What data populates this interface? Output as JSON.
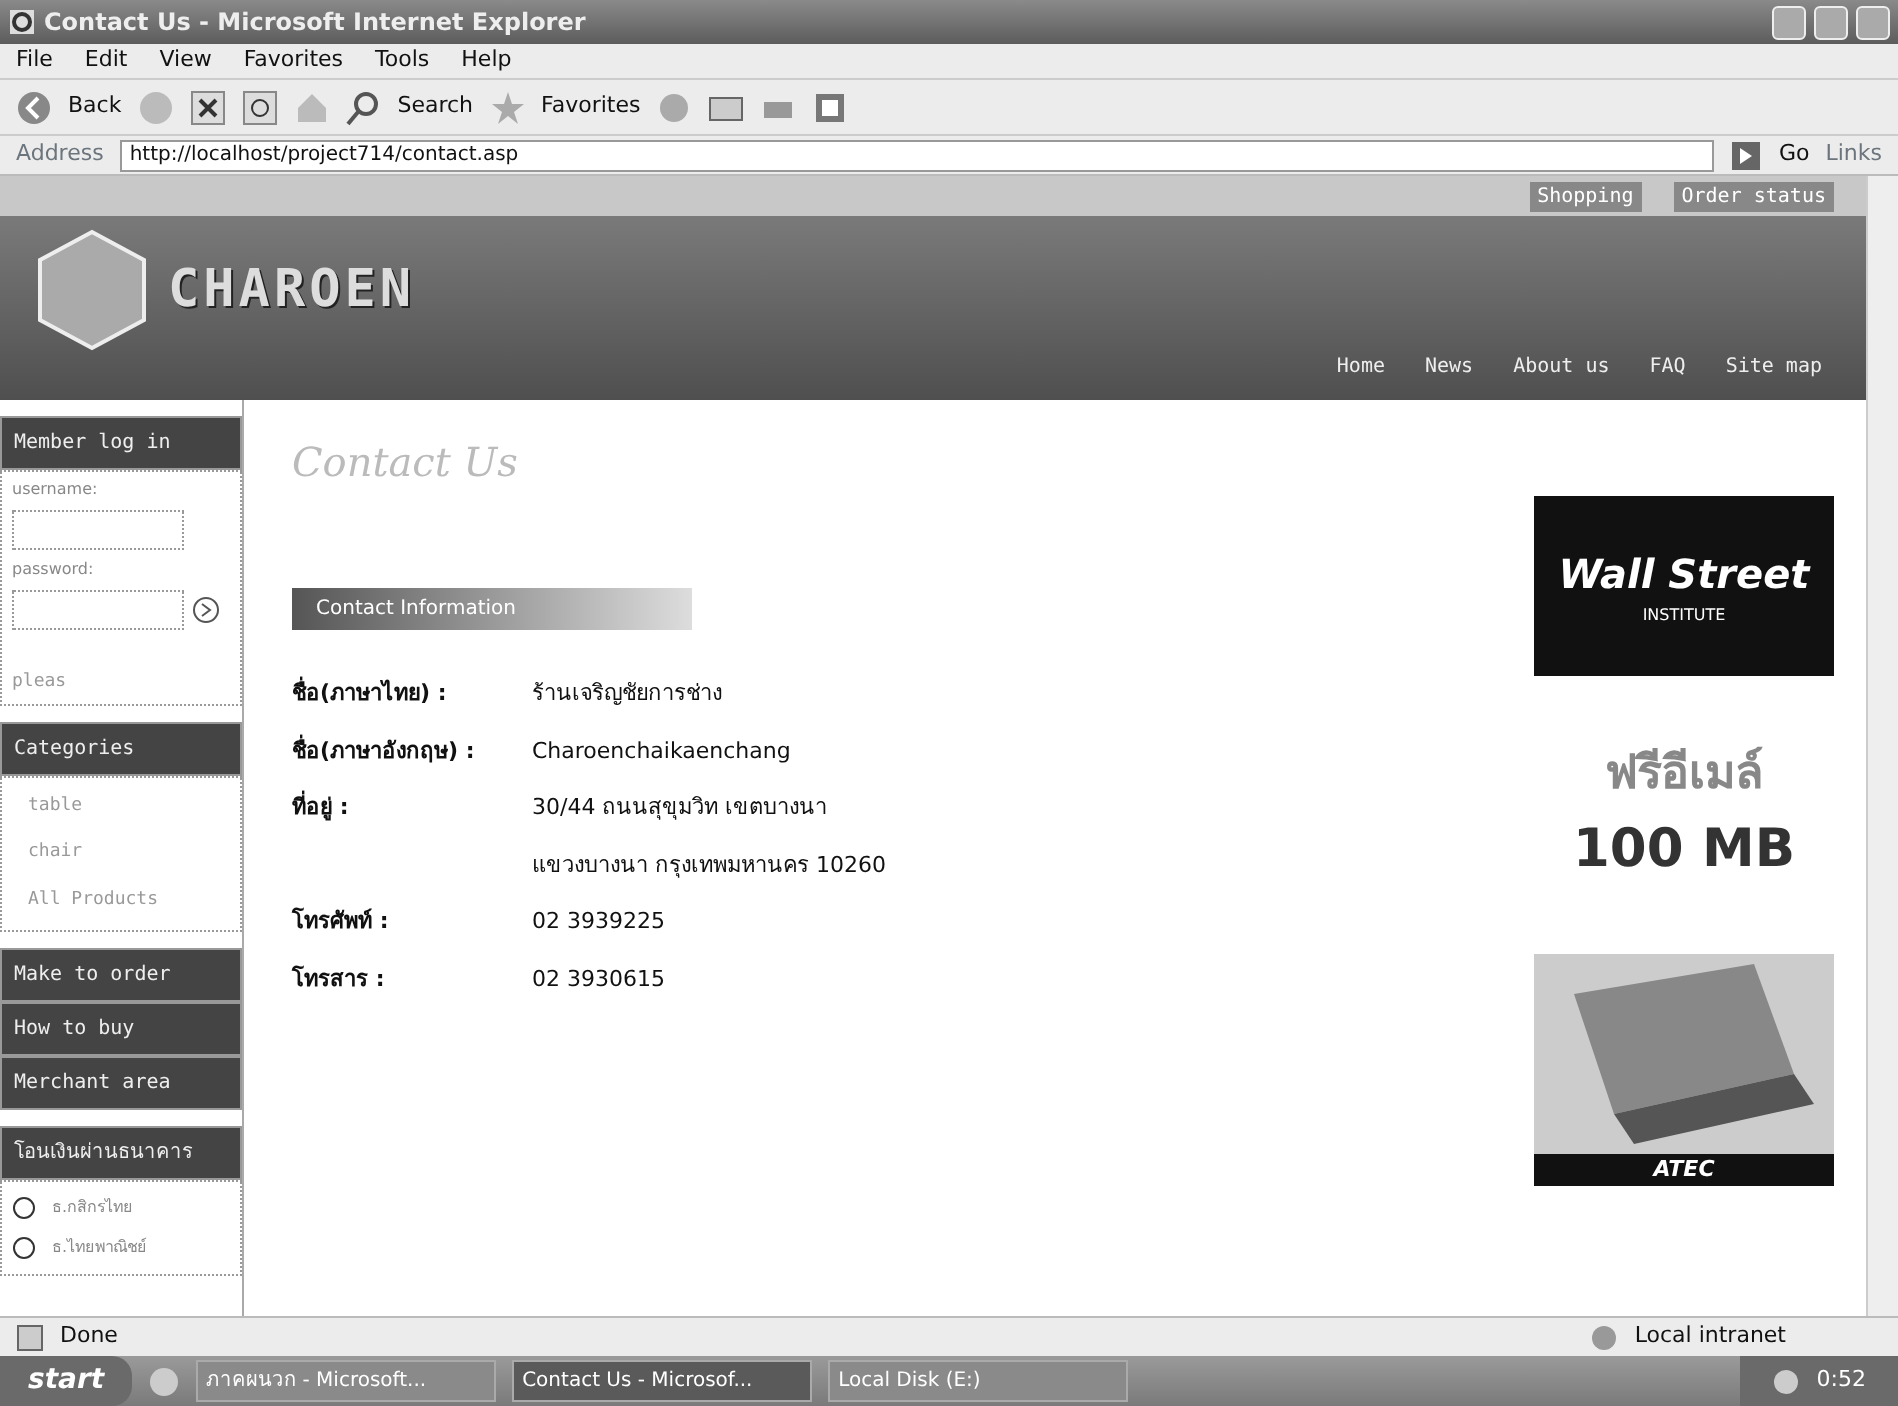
{
  "window": {
    "title": "Contact Us - Microsoft Internet Explorer"
  },
  "menu": [
    "File",
    "Edit",
    "View",
    "Favorites",
    "Tools",
    "Help"
  ],
  "toolbar": {
    "back": "Back",
    "search": "Search",
    "favorites": "Favorites"
  },
  "address": {
    "label": "Address",
    "url": "http://localhost/project714/contact.asp",
    "go": "Go",
    "links": "Links"
  },
  "site": {
    "logo": "CHAROEN",
    "top_links": [
      "Shopping",
      "Order status"
    ],
    "nav": [
      {
        "label": "Home",
        "selected": false
      },
      {
        "label": "News",
        "selected": false
      },
      {
        "label": "About us",
        "selected": false
      },
      {
        "label": "FAQ",
        "selected": false
      },
      {
        "label": "Site map",
        "selected": false
      }
    ]
  },
  "sidebar": {
    "login": {
      "title": "Member log in",
      "username_label": "username:",
      "password_label": "password:",
      "note": "pleas"
    },
    "categories": {
      "title": "Categories",
      "items": [
        "table",
        "chair",
        "All Products"
      ]
    },
    "menu": [
      "Make to order",
      "How to buy",
      "Merchant area"
    ],
    "banks": {
      "title": "โอนเงินผ่านธนาคาร",
      "items": [
        "ธ.กสิกรไทย",
        "ธ.ไทยพาณิชย์"
      ]
    }
  },
  "content": {
    "title": "Contact Us",
    "section": "Contact Information",
    "rows": [
      {
        "label": "ชื่อ(ภาษาไทย)   :",
        "value": "ร้านเจริญชัยการช่าง"
      },
      {
        "label": "ชื่อ(ภาษาอังกฤษ) :",
        "value": "Charoenchaikaenchang"
      },
      {
        "label": "ที่อยู่ :",
        "value": "30/44 ถนนสุขุมวิท เขตบางนา"
      },
      {
        "label": "",
        "value": "แขวงบางนา กรุงเทพมหานคร 10260"
      },
      {
        "label": "โทรศัพท์ :",
        "value": "02 3939225"
      },
      {
        "label": "โทรสาร :",
        "value": "02 3930615"
      }
    ]
  },
  "ads": [
    {
      "kind": "wallstreet",
      "title": "Wall Street",
      "sub": "INSTITUTE"
    },
    {
      "kind": "email",
      "title": "ฟรีอีเมล์",
      "sub": "100 MB"
    },
    {
      "kind": "laptop",
      "title": "ATEC"
    }
  ],
  "status_bar": {
    "text": "Done",
    "zone": "Local intranet"
  },
  "taskbar": {
    "start": "start",
    "tasks": [
      {
        "label": "ภาคผนวก - Microsoft...",
        "selected": false
      },
      {
        "label": "Contact Us - Microsof...",
        "selected": true
      },
      {
        "label": "Local Disk (E:)",
        "selected": false
      }
    ],
    "clock": "0:52"
  }
}
